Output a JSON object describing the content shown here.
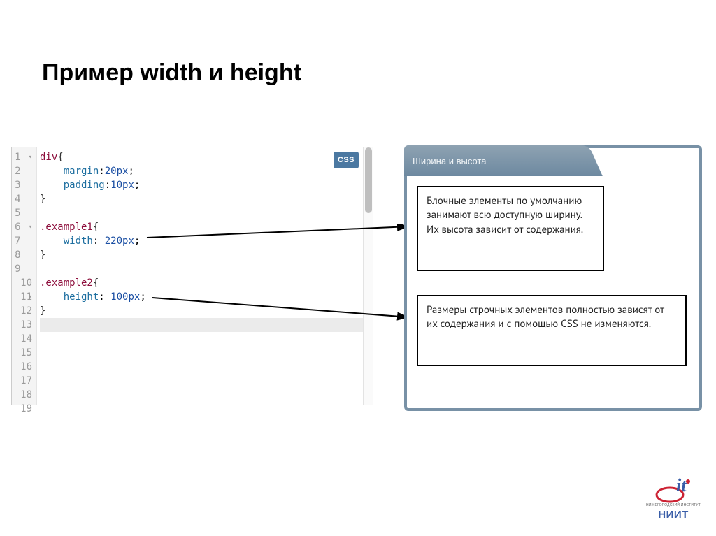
{
  "title": "Пример width и height",
  "editor": {
    "badge": "CSS",
    "total_lines": 19,
    "fold_lines": [
      1,
      6,
      10
    ],
    "cursor_line": 13,
    "lines": [
      [
        {
          "t": "div",
          "c": "sel"
        },
        {
          "t": "{",
          "c": "brace"
        }
      ],
      [
        {
          "t": "    "
        },
        {
          "t": "margin",
          "c": "prop"
        },
        {
          "t": ":"
        },
        {
          "t": "20px",
          "c": "num"
        },
        {
          "t": ";"
        }
      ],
      [
        {
          "t": "    "
        },
        {
          "t": "padding",
          "c": "prop"
        },
        {
          "t": ":"
        },
        {
          "t": "10px",
          "c": "num"
        },
        {
          "t": ";"
        }
      ],
      [
        {
          "t": "}",
          "c": "brace"
        }
      ],
      [],
      [
        {
          "t": ".example1",
          "c": "sel"
        },
        {
          "t": "{",
          "c": "brace"
        }
      ],
      [
        {
          "t": "    "
        },
        {
          "t": "width",
          "c": "prop"
        },
        {
          "t": ": "
        },
        {
          "t": "220px",
          "c": "num"
        },
        {
          "t": ";"
        }
      ],
      [
        {
          "t": "}",
          "c": "brace"
        }
      ],
      [],
      [
        {
          "t": ".example2",
          "c": "sel"
        },
        {
          "t": "{",
          "c": "brace"
        }
      ],
      [
        {
          "t": "    "
        },
        {
          "t": "height",
          "c": "prop"
        },
        {
          "t": ": "
        },
        {
          "t": "100px",
          "c": "num"
        },
        {
          "t": ";"
        }
      ],
      [
        {
          "t": "}",
          "c": "brace"
        }
      ],
      []
    ]
  },
  "result": {
    "tab_label": "Ширина и высота",
    "box1": "Блочные элементы по умолчанию занимают всю доступную ширину. Их высота зависит от содержания.",
    "box2": "Размеры строчных элементов полностью зависят от их содержания и с помощью CSS не изменяются."
  },
  "logo": {
    "text": "НИИТ",
    "sub": "НИЖЕГОРОДСКИЙ ИНСТИТУТ"
  }
}
